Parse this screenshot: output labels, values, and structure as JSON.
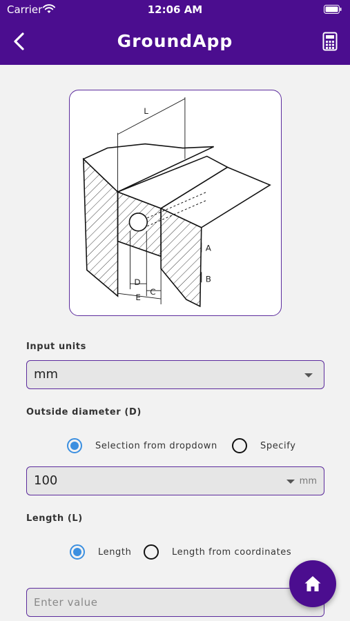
{
  "status_bar": {
    "carrier": "Carrier",
    "time": "12:06 AM"
  },
  "header": {
    "title": "GroundApp",
    "back_icon": "chevron-left-icon",
    "calculator_icon": "calculator-icon"
  },
  "diagram": {
    "labels": {
      "L": "L",
      "A": "A",
      "B": "B",
      "C": "C",
      "D": "D",
      "E": "E"
    }
  },
  "input_units": {
    "label": "Input units",
    "value": "mm"
  },
  "outside_diameter": {
    "label": "Outside diameter (D)",
    "options": [
      "Selection from dropdown",
      "Specify"
    ],
    "selected_option": "Selection from dropdown",
    "value": "100",
    "unit": "mm"
  },
  "length": {
    "label": "Length (L)",
    "options": [
      "Length",
      "Length from coordinates"
    ],
    "selected_option": "Length",
    "placeholder": "Enter value"
  },
  "fab": {
    "icon": "home-icon"
  },
  "colors": {
    "header": "#4b0d8f",
    "border": "#5b2a9c",
    "radio_selected": "#3b8fe0",
    "background": "#f2f2f2"
  }
}
